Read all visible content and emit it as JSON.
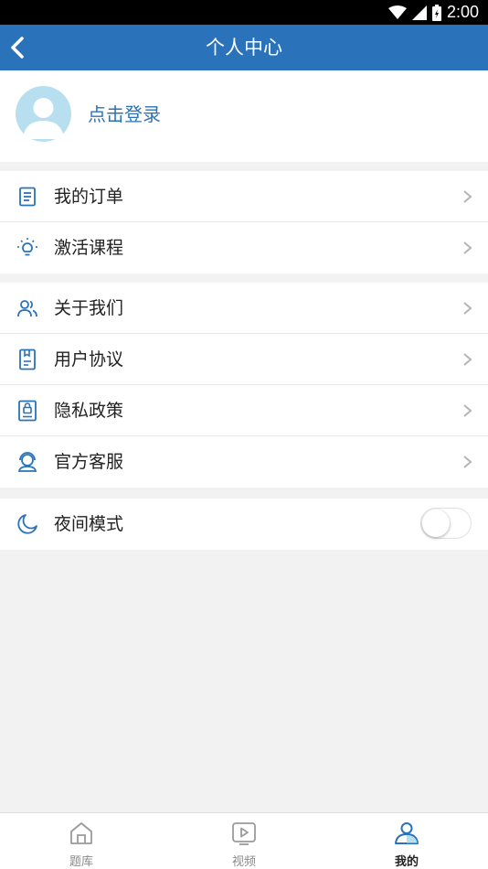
{
  "status_bar": {
    "time": "2:00"
  },
  "header": {
    "title": "个人中心"
  },
  "profile": {
    "login_label": "点击登录"
  },
  "menu_group_1": [
    {
      "label": "我的订单",
      "icon": "order-list-icon"
    },
    {
      "label": "激活课程",
      "icon": "lightbulb-icon"
    }
  ],
  "menu_group_2": [
    {
      "label": "关于我们",
      "icon": "people-icon"
    },
    {
      "label": "用户协议",
      "icon": "agreement-document-icon"
    },
    {
      "label": "隐私政策",
      "icon": "privacy-lock-icon"
    },
    {
      "label": "官方客服",
      "icon": "customer-service-icon"
    }
  ],
  "night_mode": {
    "label": "夜间模式",
    "icon": "moon-icon",
    "enabled": false
  },
  "bottom_nav": [
    {
      "label": "题库",
      "icon": "home-icon",
      "active": false
    },
    {
      "label": "视频",
      "icon": "video-icon",
      "active": false
    },
    {
      "label": "我的",
      "icon": "profile-icon",
      "active": true
    }
  ],
  "colors": {
    "accent": "#2a73ba",
    "background": "#f2f2f2",
    "avatar": "#b7dff0"
  }
}
